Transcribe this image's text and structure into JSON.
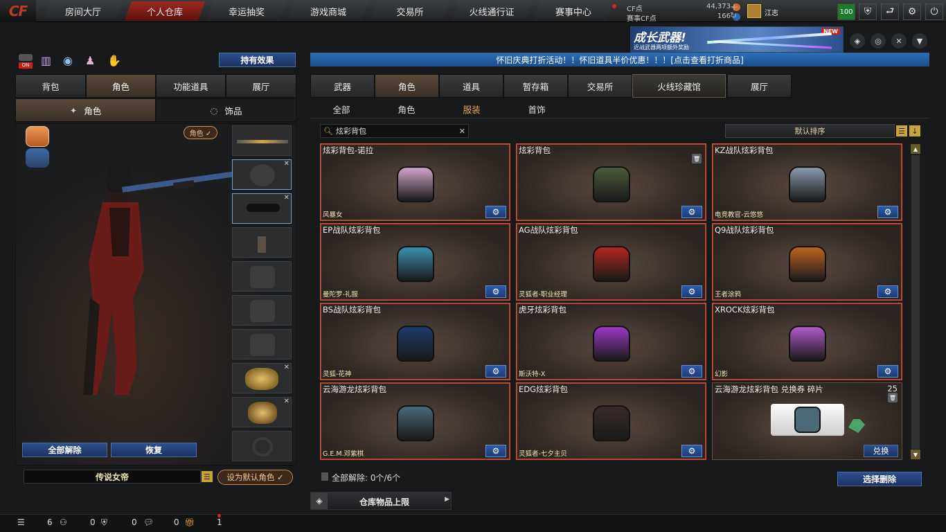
{
  "topnav": {
    "logo": "CF",
    "tabs": [
      "房间大厅",
      "个人仓库",
      "幸运抽奖",
      "游戏商城",
      "交易所",
      "火线通行证",
      "赛事中心"
    ],
    "active_index": 1,
    "currency": {
      "cf_label": "CF点",
      "cf_value": "44,373",
      "event_label": "赛事CF点",
      "event_value": "166"
    },
    "user_name": "江志",
    "badge_level": "100"
  },
  "banner": {
    "title": "成长武器!",
    "subtitle": "近战武器两项额外奖励",
    "tag": "NEW"
  },
  "left": {
    "effects_button": "持有效果",
    "tabs": [
      "背包",
      "角色",
      "功能道具",
      "展厅"
    ],
    "active_tab": 1,
    "subtabs": [
      "角色",
      "饰品"
    ],
    "role_tag": "角色 ✓",
    "release_all": "全部解除",
    "restore": "恢复",
    "role_name": "传说女帝",
    "set_default": "设为默认角色 ✓"
  },
  "right": {
    "notice": "怀旧庆典打折活动！！怀旧道具半价优惠！！！[点击查看打折商品]",
    "tabs": [
      "武器",
      "角色",
      "道具",
      "暂存箱",
      "交易所",
      "火线珍藏馆",
      "展厅"
    ],
    "active_tab": 1,
    "subtabs": [
      "全部",
      "角色",
      "服装",
      "首饰"
    ],
    "active_subtab": 2,
    "search_value": "炫彩背包",
    "sort_label": "默认排序",
    "items": [
      {
        "title": "炫彩背包-诺拉",
        "sub": "风暴女",
        "color": "#d3a4c9"
      },
      {
        "title": "炫彩背包",
        "sub": "",
        "color": "#4b5a3a"
      },
      {
        "title": "KZ战队炫彩背包",
        "sub": "电竞教官-云悠悠",
        "color": "#8b9aab"
      },
      {
        "title": "EP战队炫彩背包",
        "sub": "曼陀罗-礼服",
        "color": "#3a8fb0"
      },
      {
        "title": "AG战队炫彩背包",
        "sub": "灵狐者-职业经理",
        "color": "#b3261e"
      },
      {
        "title": "Q9战队炫彩背包",
        "sub": "王者涂鸦",
        "color": "#c0641e"
      },
      {
        "title": "BS战队炫彩背包",
        "sub": "灵狐-花神",
        "color": "#1e3a6b"
      },
      {
        "title": "虎牙炫彩背包",
        "sub": "斯沃特-X",
        "color": "#9a3ac6"
      },
      {
        "title": "XROCK炫彩背包",
        "sub": "幻影",
        "color": "#b05ac8"
      },
      {
        "title": "云海游龙炫彩背包",
        "sub": "G.E.M.邓紫棋",
        "color": "#4a6a7a"
      },
      {
        "title": "EDG炫彩背包",
        "sub": "灵狐者-七夕主贝",
        "color": "#3a2a2a"
      }
    ],
    "coupon": {
      "title": "云海游龙炫彩背包 兑换券 碎片",
      "count": "25",
      "button": "兑换"
    },
    "release_status": "全部解除: 0个/6个",
    "select_delete": "选择删除",
    "warehouse_limit": "仓库物品上限"
  },
  "bottom": {
    "c1": "6",
    "c2": "0",
    "c3": "0",
    "c4": "0",
    "c5": "1"
  }
}
